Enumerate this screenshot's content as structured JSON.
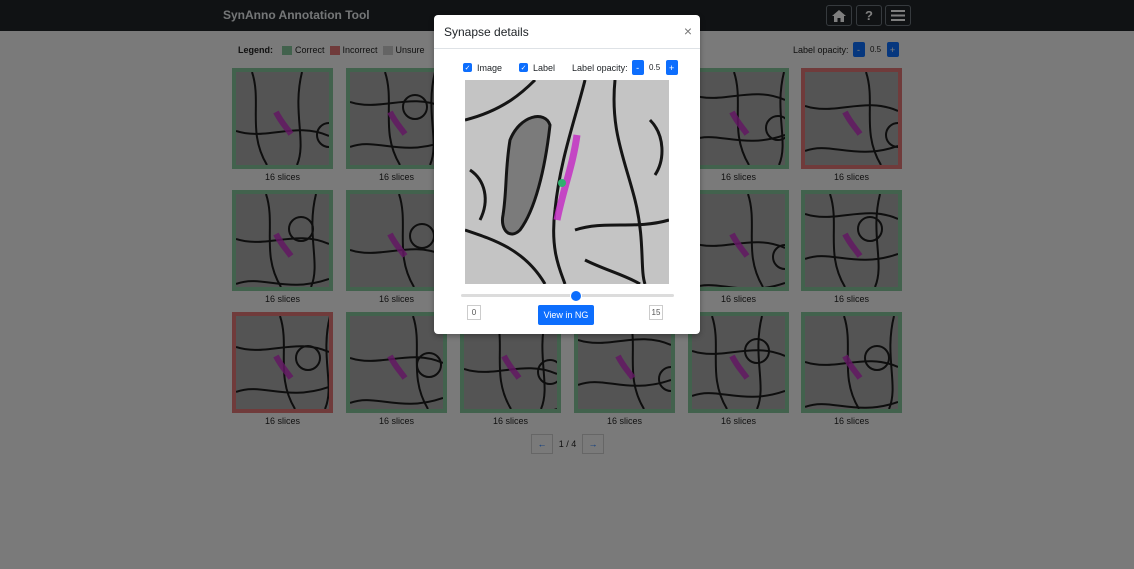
{
  "app": {
    "title": "SynAnno Annotation Tool"
  },
  "nav": {
    "buttons": [
      {
        "icon": "home-icon"
      },
      {
        "icon": "help-icon",
        "label": "?"
      },
      {
        "icon": "menu-icon"
      }
    ]
  },
  "legend": {
    "title": "Legend:",
    "items": [
      {
        "label": "Correct",
        "color": "#84c49b"
      },
      {
        "label": "Incorrect",
        "color": "#e07677"
      },
      {
        "label": "Unsure",
        "color": "#c8c8c8"
      }
    ]
  },
  "opacity": {
    "label": "Label opacity:",
    "value": "0.5",
    "minus": "-",
    "plus": "+"
  },
  "cards": [
    {
      "caption": "16 slices",
      "status": "correct"
    },
    {
      "caption": "16 slices",
      "status": "correct"
    },
    {
      "caption": "16 slices",
      "status": "correct"
    },
    {
      "caption": "16 slices",
      "status": "correct"
    },
    {
      "caption": "16 slices",
      "status": "correct"
    },
    {
      "caption": "16 slices",
      "status": "incorrect"
    },
    {
      "caption": "16 slices",
      "status": "correct"
    },
    {
      "caption": "16 slices",
      "status": "correct"
    },
    {
      "caption": "16 slices",
      "status": "correct"
    },
    {
      "caption": "16 slices",
      "status": "correct"
    },
    {
      "caption": "16 slices",
      "status": "correct"
    },
    {
      "caption": "16 slices",
      "status": "correct"
    },
    {
      "caption": "16 slices",
      "status": "incorrect"
    },
    {
      "caption": "16 slices",
      "status": "correct"
    },
    {
      "caption": "16 slices",
      "status": "correct"
    },
    {
      "caption": "16 slices",
      "status": "correct"
    },
    {
      "caption": "16 slices",
      "status": "correct"
    },
    {
      "caption": "16 slices",
      "status": "correct"
    }
  ],
  "pagination": {
    "prev": "←",
    "label": "1 / 4",
    "next": "→"
  },
  "modal": {
    "title": "Synapse details",
    "close": "×",
    "image_label": "Image",
    "label_label": "Label",
    "opacity_label": "Label opacity:",
    "opacity_value": "0.5",
    "minus": "-",
    "plus": "+",
    "slider": {
      "min": "0",
      "max": "15",
      "value": 8
    },
    "button": "View in NG"
  }
}
